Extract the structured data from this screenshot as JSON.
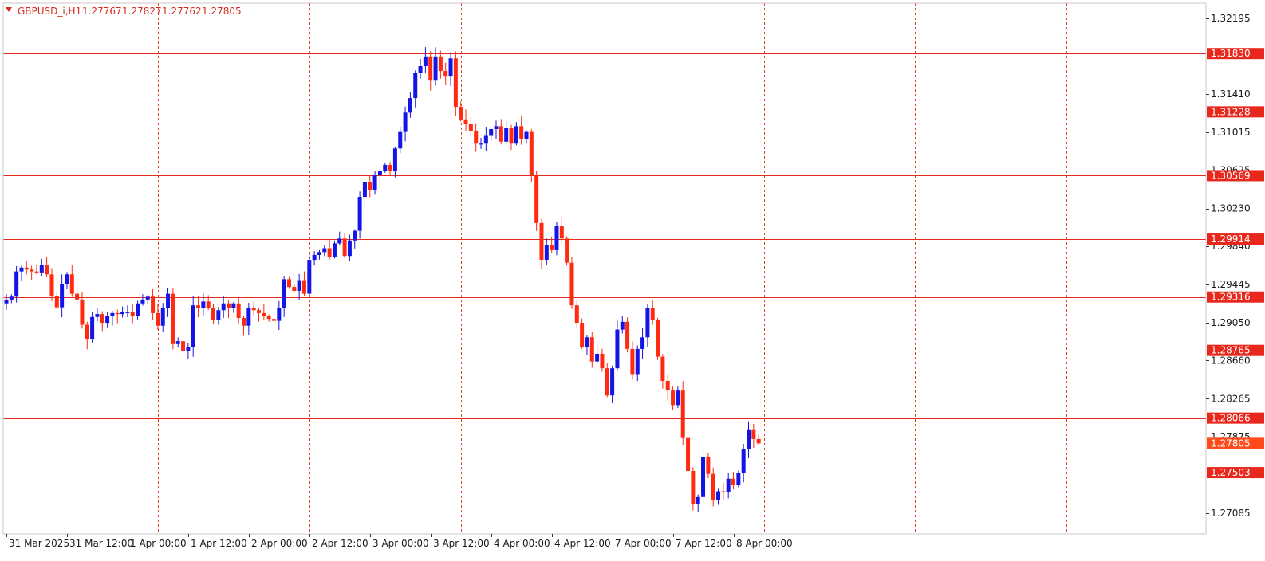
{
  "window": {
    "title": "GBPUSD_i,H1",
    "ohlc": [
      "1.27767",
      "1.27827",
      "1.27762",
      "1.27805"
    ]
  },
  "chart_data": {
    "type": "candlestick",
    "symbol": "GBPUSD_i",
    "timeframe": "H1",
    "ylim": [
      1.2687,
      1.3235
    ],
    "grid": true,
    "colors": {
      "bull": "#1414e6",
      "bear": "#ff2a10",
      "level": "#e8281c",
      "grid": "#e0412a",
      "current_price_label": "#ff4a1a"
    },
    "y_ticks": [
      "1.32195",
      "1.31410",
      "1.31015",
      "1.30625",
      "1.30230",
      "1.29840",
      "1.29445",
      "1.29050",
      "1.28660",
      "1.28265",
      "1.27875",
      "1.27085"
    ],
    "x_ticks": [
      "31 Mar 2025",
      "31 Mar 12:00",
      "1 Apr 00:00",
      "1 Apr 12:00",
      "2 Apr 00:00",
      "2 Apr 12:00",
      "3 Apr 00:00",
      "3 Apr 12:00",
      "4 Apr 00:00",
      "4 Apr 12:00",
      "7 Apr 00:00",
      "7 Apr 12:00",
      "8 Apr 00:00"
    ],
    "levels": [
      "1.31830",
      "1.31228",
      "1.30569",
      "1.29914",
      "1.29316",
      "1.28765",
      "1.28066",
      "1.27503"
    ],
    "current_price": "1.27805",
    "closes": [
      1.2929,
      1.2932,
      1.2958,
      1.2962,
      1.296,
      1.2958,
      1.2957,
      1.2965,
      1.2955,
      1.2933,
      1.2921,
      1.2945,
      1.2955,
      1.2935,
      1.2929,
      1.2903,
      1.2888,
      1.2911,
      1.2914,
      1.2905,
      1.2912,
      1.2915,
      1.2914,
      1.2916,
      1.2916,
      1.2912,
      1.2925,
      1.2929,
      1.2932,
      1.2915,
      1.2902,
      1.292,
      1.2935,
      1.2883,
      1.2886,
      1.2876,
      1.288,
      1.2923,
      1.292,
      1.2927,
      1.292,
      1.2908,
      1.2918,
      1.2925,
      1.292,
      1.2925,
      1.291,
      1.2902,
      1.292,
      1.2918,
      1.2915,
      1.2912,
      1.2909,
      1.2907,
      1.292,
      1.295,
      1.2942,
      1.2938,
      1.2949,
      1.2935,
      1.297,
      1.2975,
      1.2978,
      1.2982,
      1.2973,
      1.2987,
      1.2992,
      1.2974,
      1.299,
      1.3,
      1.3035,
      1.305,
      1.3042,
      1.3058,
      1.3062,
      1.3068,
      1.3062,
      1.3085,
      1.3102,
      1.3122,
      1.3137,
      1.3163,
      1.317,
      1.318,
      1.3155,
      1.318,
      1.3165,
      1.316,
      1.3178,
      1.3128,
      1.3115,
      1.311,
      1.3103,
      1.309,
      1.309,
      1.3098,
      1.3105,
      1.3108,
      1.3092,
      1.3106,
      1.309,
      1.3108,
      1.3095,
      1.3102,
      1.3058,
      1.3008,
      1.297,
      1.2985,
      1.298,
      1.3005,
      1.2992,
      1.2967,
      1.2923,
      1.2905,
      1.288,
      1.289,
      1.2865,
      1.2873,
      1.2858,
      1.283,
      1.2858,
      1.2898,
      1.2906,
      1.2878,
      1.2852,
      1.2878,
      1.289,
      1.292,
      1.2908,
      1.287,
      1.2845,
      1.2835,
      1.282,
      1.2835,
      1.2786,
      1.2752,
      1.2718,
      1.2725,
      1.2766,
      1.2749,
      1.2722,
      1.2731,
      1.273,
      1.2744,
      1.2738,
      1.275,
      1.2775,
      1.2795,
      1.2785,
      1.27805
    ]
  }
}
